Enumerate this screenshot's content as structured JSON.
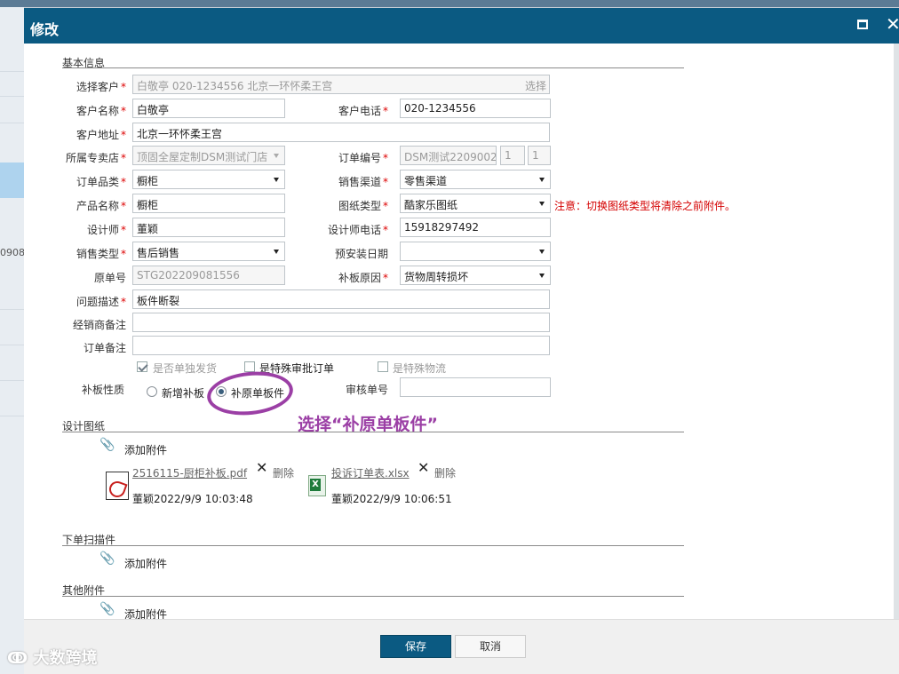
{
  "dialog": {
    "title": "修改",
    "maximize_icon": "maximize-icon",
    "close_glyph": "✕"
  },
  "background": {
    "fragment_text": "0908"
  },
  "sections": {
    "basic": "基本信息",
    "design": "设计图纸",
    "scan": "下单扫描件",
    "other": "其他附件"
  },
  "form": {
    "customer_select": {
      "label": "选择客户",
      "value": "白敬亭 020-1234556 北京一环怀柔王宫",
      "pick": "选择"
    },
    "customer_name": {
      "label": "客户名称",
      "value": "白敬亭"
    },
    "customer_phone": {
      "label": "客户电话",
      "value": "020-1234556"
    },
    "customer_address": {
      "label": "客户地址",
      "value": "北京一环怀柔王宫"
    },
    "store": {
      "label": "所属专卖店",
      "value": "顶固全屋定制DSM测试门店"
    },
    "order_no": {
      "label": "订单编号",
      "value": "DSM测试2209002",
      "n1": "1",
      "n2": "1"
    },
    "order_category": {
      "label": "订单品类",
      "value": "橱柜"
    },
    "sales_channel": {
      "label": "销售渠道",
      "value": "零售渠道"
    },
    "product_name": {
      "label": "产品名称",
      "value": "橱柜"
    },
    "drawing_type": {
      "label": "图纸类型",
      "value": "酷家乐图纸",
      "note": "注意：切换图纸类型将清除之前附件。"
    },
    "designer": {
      "label": "设计师",
      "value": "董颖"
    },
    "designer_phone": {
      "label": "设计师电话",
      "value": "15918297492"
    },
    "sales_type": {
      "label": "销售类型",
      "value": "售后销售"
    },
    "install_date": {
      "label": "预安装日期",
      "value": ""
    },
    "original_no": {
      "label": "原单号",
      "value": "STG202209081556"
    },
    "reason": {
      "label": "补板原因",
      "value": "货物周转损坏"
    },
    "problem": {
      "label": "问题描述",
      "value": "板件断裂"
    },
    "dealer_note": {
      "label": "经销商备注",
      "value": ""
    },
    "order_note": {
      "label": "订单备注",
      "value": ""
    },
    "checks": {
      "separate": "是否单独发货",
      "special_approval": "是特殊审批订单",
      "special_logistics": "是特殊物流"
    },
    "patch_type": {
      "label": "补板性质",
      "opt_new": "新增补板",
      "opt_original": "补原单板件"
    },
    "audit_no": {
      "label": "审核单号",
      "value": ""
    }
  },
  "annotation": {
    "text": "选择“补原单板件”",
    "color": "#9b3fa5"
  },
  "attachments": {
    "add_label": "添加附件",
    "delete_label": "删除",
    "files": [
      {
        "name": "2516115-厨柜补板.pdf",
        "meta": "董颖2022/9/9 10:03:48",
        "icon": "pdf-icon"
      },
      {
        "name": "投诉订单表.xlsx",
        "meta": "董颖2022/9/9 10:06:51",
        "icon": "excel-icon"
      }
    ]
  },
  "footer": {
    "save": "保存",
    "cancel": "取消"
  },
  "watermark": "大数跨境",
  "colors": {
    "header": "#0b5a82",
    "required": "#dd0000",
    "note": "#d40000"
  }
}
